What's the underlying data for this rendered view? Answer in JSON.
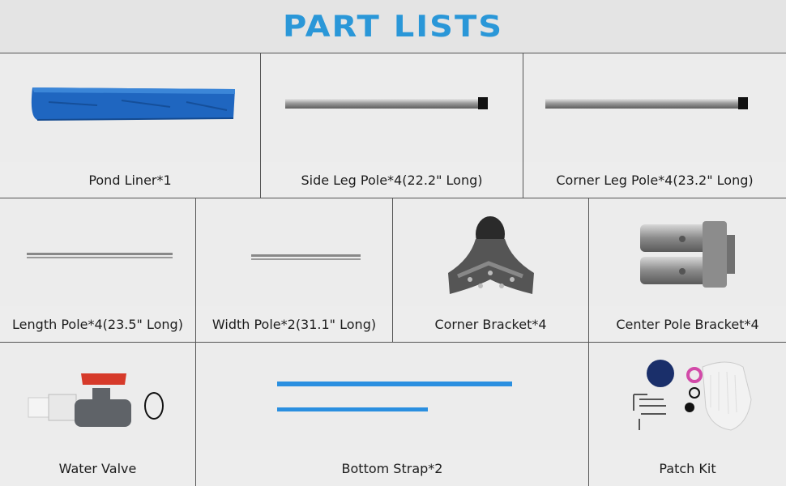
{
  "title": "PART LISTS",
  "parts": [
    {
      "label": "Pond Liner*1",
      "icon": "pond-liner-icon"
    },
    {
      "label": "Side Leg Pole*4(22.2\" Long)",
      "icon": "side-leg-pole-icon"
    },
    {
      "label": "Corner Leg Pole*4(23.2\" Long)",
      "icon": "corner-leg-pole-icon"
    },
    {
      "label": "Length Pole*4(23.5\" Long)",
      "icon": "length-pole-icon"
    },
    {
      "label": "Width Pole*2(31.1\" Long)",
      "icon": "width-pole-icon"
    },
    {
      "label": "Corner Bracket*4",
      "icon": "corner-bracket-icon"
    },
    {
      "label": "Center Pole Bracket*4",
      "icon": "center-pole-bracket-icon"
    },
    {
      "label": "Water Valve",
      "icon": "water-valve-icon"
    },
    {
      "label": "Bottom Strap*2",
      "icon": "bottom-strap-icon"
    },
    {
      "label": "Patch Kit",
      "icon": "patch-kit-icon"
    }
  ],
  "colors": {
    "title": "#2a97d8",
    "liner": "#1f66c0",
    "strap": "#2a8fe0",
    "valve_handle": "#d63a2a"
  }
}
